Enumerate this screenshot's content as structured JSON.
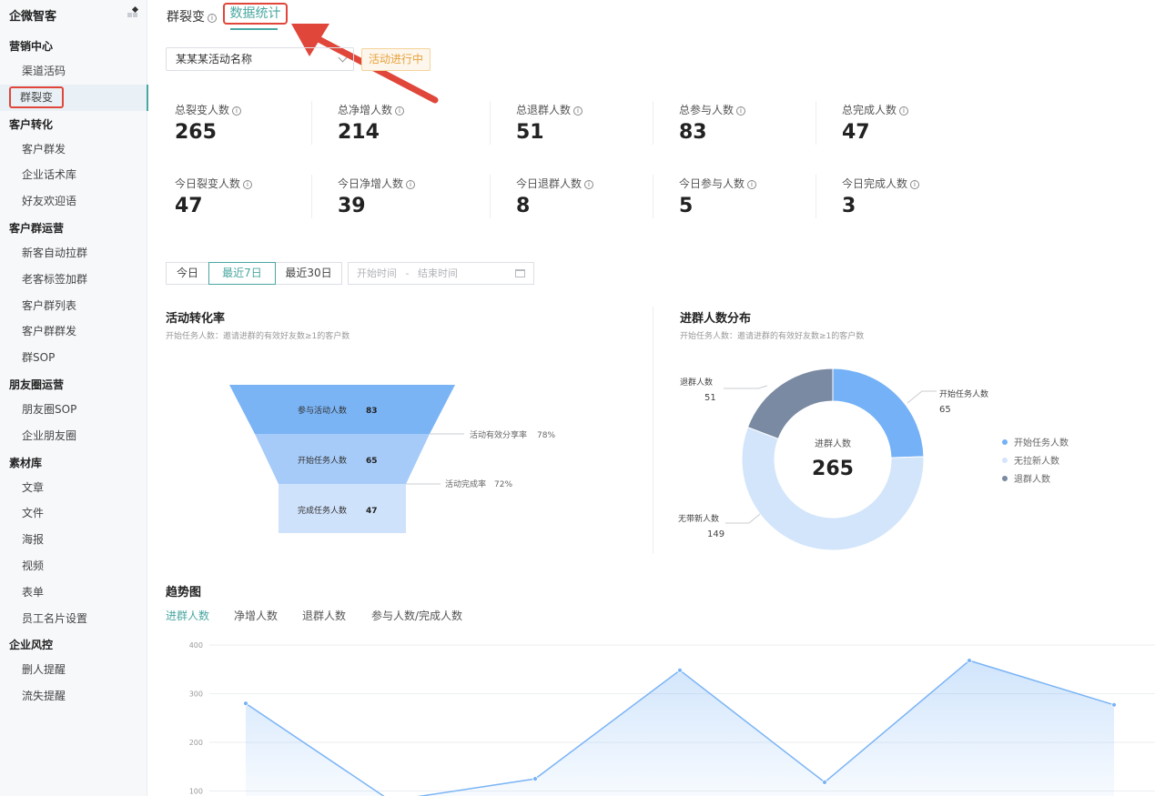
{
  "sidebar": {
    "brand": "企微智客",
    "groups": [
      {
        "title": "营销中心",
        "items": [
          "渠道活码",
          "群裂变"
        ]
      },
      {
        "title": "客户转化",
        "items": [
          "客户群发",
          "企业话术库",
          "好友欢迎语"
        ]
      },
      {
        "title": "客户群运营",
        "items": [
          "新客自动拉群",
          "老客标签加群",
          "客户群列表",
          "客户群群发",
          "群SOP"
        ]
      },
      {
        "title": "朋友圈运营",
        "items": [
          "朋友圈SOP",
          "企业朋友圈"
        ]
      },
      {
        "title": "素材库",
        "items": [
          "文章",
          "文件",
          "海报",
          "视频",
          "表单",
          "员工名片设置"
        ]
      },
      {
        "title": "企业风控",
        "items": [
          "删人提醒",
          "流失提醒"
        ]
      }
    ],
    "active_item": "群裂变"
  },
  "header": {
    "tab_fission": "群裂变",
    "tab_stats": "数据统计"
  },
  "filter": {
    "activity_name": "某某某活动名称",
    "activity_status": "活动进行中"
  },
  "stats": {
    "total": [
      {
        "label": "总裂变人数",
        "value": "265"
      },
      {
        "label": "总净增人数",
        "value": "214"
      },
      {
        "label": "总退群人数",
        "value": "51"
      },
      {
        "label": "总参与人数",
        "value": "83"
      },
      {
        "label": "总完成人数",
        "value": "47"
      }
    ],
    "today": [
      {
        "label": "今日裂变人数",
        "value": "47"
      },
      {
        "label": "今日净增人数",
        "value": "39"
      },
      {
        "label": "今日退群人数",
        "value": "8"
      },
      {
        "label": "今日参与人数",
        "value": "5"
      },
      {
        "label": "今日完成人数",
        "value": "3"
      }
    ]
  },
  "date_filter": {
    "today": "今日",
    "last7": "最近7日",
    "last30": "最近30日",
    "start_placeholder": "开始时间",
    "separator": "-",
    "end_placeholder": "结束时间"
  },
  "funnel": {
    "title": "活动转化率",
    "subtitle": "开始任务人数：邀请进群的有效好友数≥1的客户数",
    "stages": [
      {
        "label": "参与活动人数",
        "value": "83"
      },
      {
        "label": "开始任务人数",
        "value": "65"
      },
      {
        "label": "完成任务人数",
        "value": "47"
      }
    ],
    "rates": [
      {
        "label": "活动有效分享率",
        "value": "78%"
      },
      {
        "label": "活动完成率",
        "value": "72%"
      }
    ],
    "colors": [
      "#7ab4f5",
      "#a6cbf8",
      "#cfe2fb"
    ]
  },
  "donut": {
    "title": "进群人数分布",
    "subtitle": "开始任务人数：邀请进群的有效好友数≥1的客户数",
    "center_label": "进群人数",
    "center_value": "265",
    "segments": [
      {
        "name": "开始任务人数",
        "value": 65,
        "color": "#74b1f6"
      },
      {
        "name": "无拉新人数",
        "value": 149,
        "color": "#d3e5fb"
      },
      {
        "name": "退群人数",
        "value": 51,
        "color": "#7a8aa3"
      }
    ],
    "labels": {
      "start": {
        "name": "开始任务人数",
        "value": "65"
      },
      "none": {
        "name": "无带新人数",
        "value": "149"
      },
      "quit": {
        "name": "退群人数",
        "value": "51"
      }
    },
    "legend": [
      "开始任务人数",
      "无拉新人数",
      "退群人数"
    ]
  },
  "trend": {
    "title": "趋势图",
    "tabs": [
      "进群人数",
      "净增人数",
      "退群人数",
      "参与人数/完成人数"
    ],
    "active_tab": "进群人数"
  },
  "chart_data": {
    "type": "area",
    "x": [
      1,
      2,
      3,
      4,
      5,
      6,
      7
    ],
    "values": [
      280,
      80,
      125,
      348,
      118,
      368,
      277
    ],
    "yticks": [
      "400",
      "300",
      "200",
      "100"
    ],
    "ylim": [
      0,
      400
    ],
    "grid": true,
    "color": "#7ab4f5"
  }
}
